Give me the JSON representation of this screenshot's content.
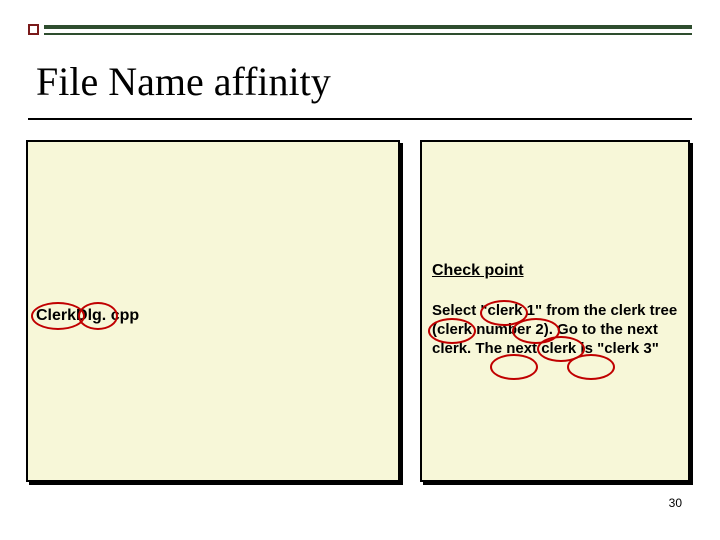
{
  "title": "File Name affinity",
  "left_panel": {
    "filename": "ClerkDlg. cpp"
  },
  "right_panel": {
    "heading": "Check point",
    "instructions": "Select \"clerk 1\" from the clerk tree (clerk number 2). Go to the next clerk. The next clerk is \"clerk 3\""
  },
  "page_number": "30"
}
